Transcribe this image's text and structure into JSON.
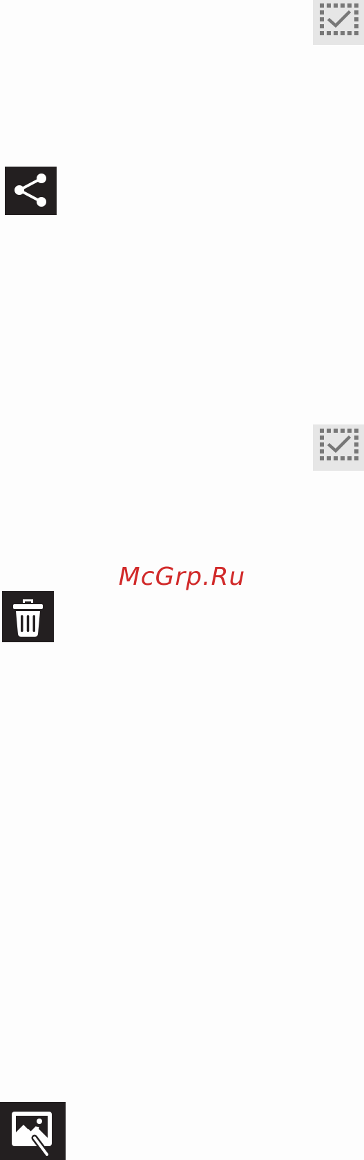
{
  "icons": [
    {
      "name": "select-all-icon"
    },
    {
      "name": "share-icon"
    },
    {
      "name": "select-all-icon"
    },
    {
      "name": "delete-icon"
    },
    {
      "name": "edit-image-icon"
    }
  ],
  "watermark": {
    "text": "McGrp.Ru",
    "color": "#d12a2a"
  },
  "colors": {
    "background": "#fdfdfd",
    "light_icon_bg": "#e6e6e6",
    "dark_icon_bg": "#231f20",
    "light_icon_fg": "#777777",
    "dark_icon_fg": "#ffffff"
  }
}
